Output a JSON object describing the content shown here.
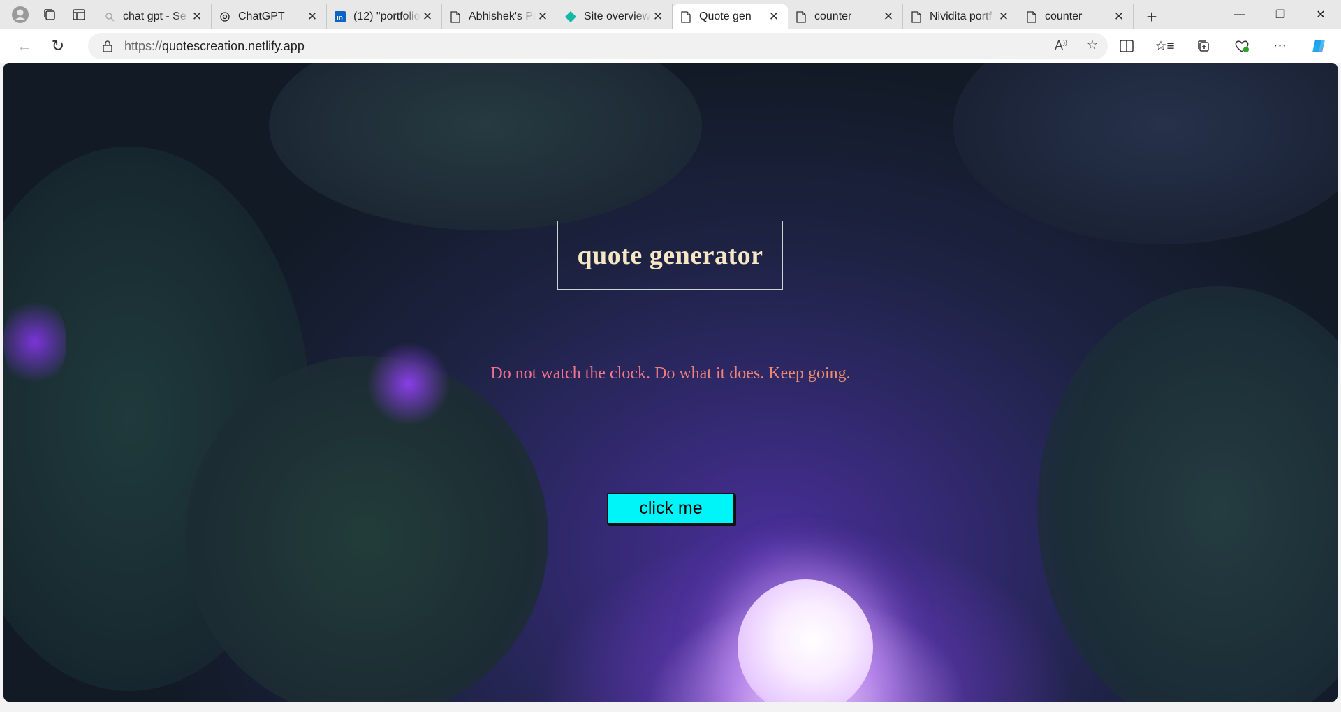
{
  "browser": {
    "tabs": [
      {
        "title": "chat gpt - Se",
        "icon": "search-icon"
      },
      {
        "title": "ChatGPT",
        "icon": "chatgpt-icon"
      },
      {
        "title": "(12) \"portfolio",
        "icon": "linkedin-icon"
      },
      {
        "title": "Abhishek's Po",
        "icon": "page-icon"
      },
      {
        "title": "Site overview",
        "icon": "netlify-icon"
      },
      {
        "title": "Quote gen",
        "icon": "page-icon",
        "active": true
      },
      {
        "title": "counter",
        "icon": "page-icon"
      },
      {
        "title": "Nividita portf",
        "icon": "page-icon"
      },
      {
        "title": "counter",
        "icon": "page-icon"
      }
    ],
    "url_protocol": "https://",
    "url_host": "quotescreation.netlify.app"
  },
  "page": {
    "title": "quote generator",
    "quote": "Do not watch the clock. Do what it does. Keep going.",
    "button_label": "click me"
  },
  "colors": {
    "button_bg": "#00f5f8",
    "title_color": "#f5e6c4",
    "quote_gradient_start": "#e8529a",
    "quote_gradient_end": "#f4b040"
  }
}
